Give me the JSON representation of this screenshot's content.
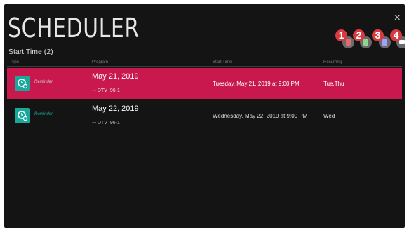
{
  "header": {
    "title": "SCHEDULER",
    "subtitle": "Start Time (2)",
    "close_glyph": "×"
  },
  "toolbar": {
    "buttons": [
      {
        "number": "1",
        "icon": "recording-icon",
        "glyph_color": "#e06a70"
      },
      {
        "number": "2",
        "icon": "record-list-icon",
        "glyph_color": "#8fd48f"
      },
      {
        "number": "3",
        "icon": "manual-schedule-icon",
        "glyph_color": "#a0a0ff"
      },
      {
        "number": "4",
        "icon": "message-icon",
        "glyph_color": "#ffffff"
      }
    ],
    "badge_color": "#d83a40"
  },
  "table": {
    "columns": [
      "Type",
      "Program",
      "Start Time",
      "Recurring"
    ],
    "rows": [
      {
        "type": "Reminder",
        "program_date": "May 21, 2019",
        "channel_arrow": "⇢",
        "channel_source": "DTV",
        "channel_number": "96-1",
        "start_time": "Tuesday, May 21, 2019 at 9:00 PM",
        "recurring": "Tue,Thu",
        "selected": true
      },
      {
        "type": "Reminder",
        "program_date": "May 22, 2019",
        "channel_arrow": "⇢",
        "channel_source": "DTV",
        "channel_number": "96-1",
        "start_time": "Wednesday, May 22, 2019 at 9:00 PM",
        "recurring": "Wed",
        "selected": false
      }
    ]
  },
  "colors": {
    "background": "#141414",
    "selected_row": "#c8184d",
    "reminder_icon": "#19a89c"
  }
}
